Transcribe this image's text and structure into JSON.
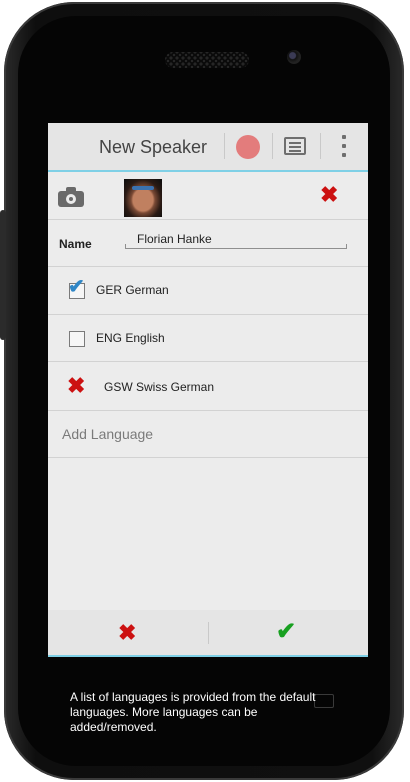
{
  "actionbar": {
    "title": "New Speaker",
    "record_icon": "record-circle",
    "list_icon": "list",
    "overflow_icon": "more-vertical"
  },
  "photo_row": {
    "camera_icon": "camera",
    "avatar_icon": "speaker-photo",
    "remove_icon": "red-x"
  },
  "name_field": {
    "label": "Name",
    "value": "Florian Hanke"
  },
  "languages": [
    {
      "code": "GER",
      "name": "German",
      "label": "GER German",
      "checked": true
    },
    {
      "code": "ENG",
      "name": "English",
      "label": "ENG English",
      "checked": false
    },
    {
      "code": "GSW",
      "name": "Swiss German",
      "label": "GSW Swiss German",
      "removable": true
    }
  ],
  "add_language": {
    "label": "Add Language"
  },
  "bottom_bar": {
    "cancel_icon": "red-x",
    "confirm_icon": "green-check"
  },
  "caption": "A list of languages is provided from the default languages. More languages can be added/removed.",
  "colors": {
    "accent": "#7fd0e6",
    "record": "#e37c7c",
    "remove": "#cc1111",
    "confirm": "#18a020",
    "checkbox_check": "#2f86c6"
  }
}
